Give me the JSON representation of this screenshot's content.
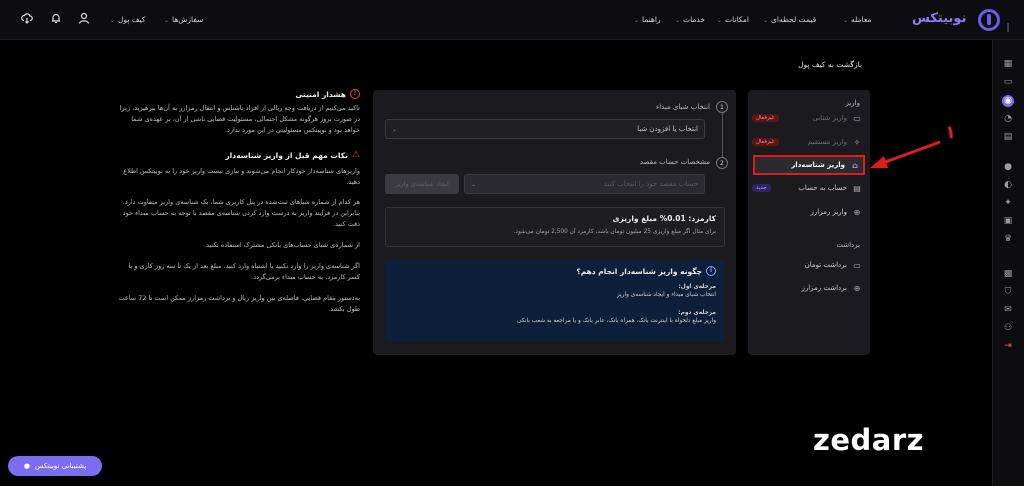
{
  "topbar": {
    "logo_text": "نوبیتکس",
    "nav": [
      {
        "label": "معامله"
      },
      {
        "label": "قیمت لحظه‌ای"
      },
      {
        "label": "امکانات"
      },
      {
        "label": "خدمات"
      },
      {
        "label": "راهنما"
      }
    ],
    "wallet_label": "کیف پول",
    "orders_label": "سفارش‌ها"
  },
  "breadcrumb": {
    "back_label": "بازگشت به کیف پول"
  },
  "sidebar": {
    "deposit_title": "واریز",
    "deposit_items": [
      {
        "label": "واریز شتابی",
        "badge": "غیرفعال"
      },
      {
        "label": "واریز مستقیم",
        "badge": "غیرفعال"
      },
      {
        "label": "واریز شناسه‌دار",
        "badge": ""
      },
      {
        "label": "حساب به حساب",
        "badge": "جدید"
      },
      {
        "label": "واریز رمزارز",
        "badge": ""
      }
    ],
    "withdraw_title": "برداشت",
    "withdraw_items": [
      {
        "label": "برداشت تومان"
      },
      {
        "label": "برداشت رمزارز"
      }
    ]
  },
  "form": {
    "step1_num": "1",
    "step1_label": "انتخاب شبای مبداء",
    "step1_select": "انتخاب یا افزودن شبا",
    "step2_num": "2",
    "step2_label": "مشخصات حساب مقصد",
    "step2_input_placeholder": "حساب مقصد خود را انتخاب کنید",
    "step2_button": "ایجاد شناسه‌ی واریز",
    "fee_title": "کارمزد: 0.01% مبلغ واریزی",
    "fee_sub": "برای مثال اگر مبلغ واریزی 25 میلیون تومان باشد، کارمزد آن 2,500 تومان می‌شود.",
    "info_title": "چگونه واریز شناسه‌دار انجام دهم؟",
    "info_step1_title": "مرحله‌ی اول:",
    "info_step1_text": "انتخاب شبای مبداء و ایجاد شناسه‌ی واریز",
    "info_step2_title": "مرحله‌ی دوم:",
    "info_step2_text": "واریز مبلغ دلخواه با اینترنت بانک، همراه بانک، عابر بانک و یا مراجعه به شعب بانکی"
  },
  "notes": {
    "security_title": "هشدار امنیتی",
    "security_text": "تاکید می‌کنیم از دریافت وجه ریالی از افراد ناشناس و انتقال رمزارز به آن‌ها بپرهیزید، زیرا در صورت بروز هرگونه مشکل احتمالی، مسئولیت قضایی ناشی از آن، بر عهده‌ی شما خواهد بود و نوبیتکس مسئولیتی در این مورد ندارد.",
    "tips_title": "نکات مهم قبل از واریز شناسه‌دار",
    "tips": [
      "واریزهای شناسه‌دار خودکار انجام می‌شوند و نیازی نیست واریز خود را به نوبیتکس اطلاع دهید.",
      "هر کدام از شماره شباهای ثبت‌شده در پنل کاربری شما، یک شناسه‌ی واریز متفاوت دارد. بنابراین در فرایند واریز به درست وارد کردن شناسه‌ی مقصد با توجه به حساب مبداء خود دقت کنید.",
      "از شماره‌ی شبای حساب‌های بانکی مشترک استفاده نکنید.",
      "اگر شناسه‌ی واریز را وارد نکنید یا اشتباه وارد کنید، مبلغ بعد از یک تا سه روز کاری و با کسر کارمزد، به حساب مبداء برمی‌گردد.",
      "به‌دستور مقام قضایی، فاصله‌ی بین واریز ریال و برداشت رمزارز ممکن است تا 72 ساعت طول بکشد."
    ]
  },
  "support": {
    "label": "پشتیبانی نوبیتکس"
  },
  "annotation": {
    "number": "۱"
  },
  "watermark": "zedarz",
  "colors": {
    "accent": "#7c6cf0",
    "highlight": "#e21b1b",
    "info_bg": "#0e1f3a"
  }
}
